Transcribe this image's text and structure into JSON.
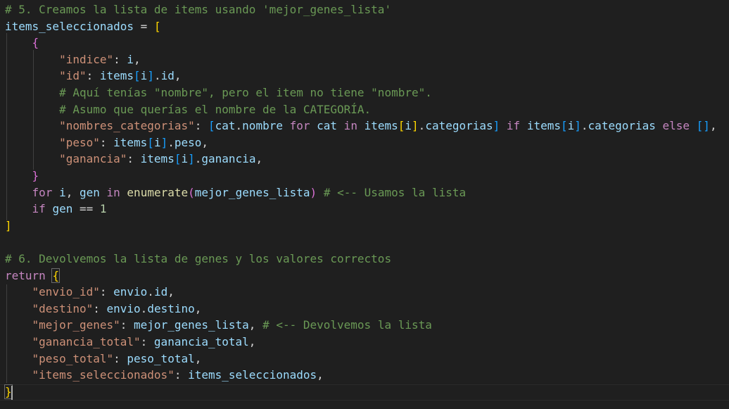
{
  "editor": {
    "language": "python",
    "theme": "dark",
    "lines": [
      [
        {
          "t": "# 5. Creamos la lista de items usando 'mejor_genes_lista'",
          "c": "comment"
        }
      ],
      [
        {
          "t": "items_seleccionados",
          "c": "var"
        },
        {
          "t": " = ",
          "c": "op"
        },
        {
          "t": "[",
          "c": "b1"
        }
      ],
      [
        {
          "t": "    ",
          "c": "plain"
        },
        {
          "t": "{",
          "c": "b2"
        }
      ],
      [
        {
          "t": "        ",
          "c": "plain"
        },
        {
          "t": "\"indice\"",
          "c": "str"
        },
        {
          "t": ": ",
          "c": "op"
        },
        {
          "t": "i",
          "c": "var"
        },
        {
          "t": ",",
          "c": "op"
        }
      ],
      [
        {
          "t": "        ",
          "c": "plain"
        },
        {
          "t": "\"id\"",
          "c": "str"
        },
        {
          "t": ": ",
          "c": "op"
        },
        {
          "t": "items",
          "c": "var"
        },
        {
          "t": "[",
          "c": "b3"
        },
        {
          "t": "i",
          "c": "var"
        },
        {
          "t": "]",
          "c": "b3"
        },
        {
          "t": ".",
          "c": "op"
        },
        {
          "t": "id",
          "c": "var"
        },
        {
          "t": ",",
          "c": "op"
        }
      ],
      [
        {
          "t": "        ",
          "c": "plain"
        },
        {
          "t": "# Aquí tenías \"nombre\", pero el item no tiene \"nombre\".",
          "c": "comment"
        }
      ],
      [
        {
          "t": "        ",
          "c": "plain"
        },
        {
          "t": "# Asumo que querías el nombre de la CATEGORÍA.",
          "c": "comment"
        }
      ],
      [
        {
          "t": "        ",
          "c": "plain"
        },
        {
          "t": "\"nombres_categorias\"",
          "c": "str"
        },
        {
          "t": ": ",
          "c": "op"
        },
        {
          "t": "[",
          "c": "b3"
        },
        {
          "t": "cat",
          "c": "var"
        },
        {
          "t": ".",
          "c": "op"
        },
        {
          "t": "nombre",
          "c": "var"
        },
        {
          "t": " for ",
          "c": "kw"
        },
        {
          "t": "cat",
          "c": "var"
        },
        {
          "t": " in ",
          "c": "kw"
        },
        {
          "t": "items",
          "c": "var"
        },
        {
          "t": "[",
          "c": "b1"
        },
        {
          "t": "i",
          "c": "var"
        },
        {
          "t": "]",
          "c": "b1"
        },
        {
          "t": ".",
          "c": "op"
        },
        {
          "t": "categorias",
          "c": "var"
        },
        {
          "t": "]",
          "c": "b3"
        },
        {
          "t": " if ",
          "c": "kw"
        },
        {
          "t": "items",
          "c": "var"
        },
        {
          "t": "[",
          "c": "b3"
        },
        {
          "t": "i",
          "c": "var"
        },
        {
          "t": "]",
          "c": "b3"
        },
        {
          "t": ".",
          "c": "op"
        },
        {
          "t": "categorias",
          "c": "var"
        },
        {
          "t": " else ",
          "c": "kw"
        },
        {
          "t": "[]",
          "c": "b3"
        },
        {
          "t": ",",
          "c": "op"
        }
      ],
      [
        {
          "t": "        ",
          "c": "plain"
        },
        {
          "t": "\"peso\"",
          "c": "str"
        },
        {
          "t": ": ",
          "c": "op"
        },
        {
          "t": "items",
          "c": "var"
        },
        {
          "t": "[",
          "c": "b3"
        },
        {
          "t": "i",
          "c": "var"
        },
        {
          "t": "]",
          "c": "b3"
        },
        {
          "t": ".",
          "c": "op"
        },
        {
          "t": "peso",
          "c": "var"
        },
        {
          "t": ",",
          "c": "op"
        }
      ],
      [
        {
          "t": "        ",
          "c": "plain"
        },
        {
          "t": "\"ganancia\"",
          "c": "str"
        },
        {
          "t": ": ",
          "c": "op"
        },
        {
          "t": "items",
          "c": "var"
        },
        {
          "t": "[",
          "c": "b3"
        },
        {
          "t": "i",
          "c": "var"
        },
        {
          "t": "]",
          "c": "b3"
        },
        {
          "t": ".",
          "c": "op"
        },
        {
          "t": "ganancia",
          "c": "var"
        },
        {
          "t": ",",
          "c": "op"
        }
      ],
      [
        {
          "t": "    ",
          "c": "plain"
        },
        {
          "t": "}",
          "c": "b2"
        }
      ],
      [
        {
          "t": "    ",
          "c": "plain"
        },
        {
          "t": "for",
          "c": "kw"
        },
        {
          "t": " ",
          "c": "plain"
        },
        {
          "t": "i",
          "c": "var"
        },
        {
          "t": ", ",
          "c": "op"
        },
        {
          "t": "gen",
          "c": "var"
        },
        {
          "t": " in ",
          "c": "kw"
        },
        {
          "t": "enumerate",
          "c": "fn"
        },
        {
          "t": "(",
          "c": "b2"
        },
        {
          "t": "mejor_genes_lista",
          "c": "var"
        },
        {
          "t": ")",
          "c": "b2"
        },
        {
          "t": " ",
          "c": "plain"
        },
        {
          "t": "# <-- Usamos la lista",
          "c": "comment"
        }
      ],
      [
        {
          "t": "    ",
          "c": "plain"
        },
        {
          "t": "if",
          "c": "kw"
        },
        {
          "t": " ",
          "c": "plain"
        },
        {
          "t": "gen",
          "c": "var"
        },
        {
          "t": " == ",
          "c": "op"
        },
        {
          "t": "1",
          "c": "num"
        }
      ],
      [
        {
          "t": "]",
          "c": "b1"
        }
      ],
      [],
      [
        {
          "t": "# 6. Devolvemos la lista de genes y los valores correctos",
          "c": "comment"
        }
      ],
      [
        {
          "t": "return",
          "c": "kw"
        },
        {
          "t": " ",
          "c": "plain"
        },
        {
          "t": "{",
          "c": "b1"
        }
      ],
      [
        {
          "t": "    ",
          "c": "plain"
        },
        {
          "t": "\"envio_id\"",
          "c": "str"
        },
        {
          "t": ": ",
          "c": "op"
        },
        {
          "t": "envio",
          "c": "var"
        },
        {
          "t": ".",
          "c": "op"
        },
        {
          "t": "id",
          "c": "var"
        },
        {
          "t": ",",
          "c": "op"
        }
      ],
      [
        {
          "t": "    ",
          "c": "plain"
        },
        {
          "t": "\"destino\"",
          "c": "str"
        },
        {
          "t": ": ",
          "c": "op"
        },
        {
          "t": "envio",
          "c": "var"
        },
        {
          "t": ".",
          "c": "op"
        },
        {
          "t": "destino",
          "c": "var"
        },
        {
          "t": ",",
          "c": "op"
        }
      ],
      [
        {
          "t": "    ",
          "c": "plain"
        },
        {
          "t": "\"mejor_genes\"",
          "c": "str"
        },
        {
          "t": ": ",
          "c": "op"
        },
        {
          "t": "mejor_genes_lista",
          "c": "var"
        },
        {
          "t": ", ",
          "c": "op"
        },
        {
          "t": "# <-- Devolvemos la lista",
          "c": "comment"
        }
      ],
      [
        {
          "t": "    ",
          "c": "plain"
        },
        {
          "t": "\"ganancia_total\"",
          "c": "str"
        },
        {
          "t": ": ",
          "c": "op"
        },
        {
          "t": "ganancia_total",
          "c": "var"
        },
        {
          "t": ",",
          "c": "op"
        }
      ],
      [
        {
          "t": "    ",
          "c": "plain"
        },
        {
          "t": "\"peso_total\"",
          "c": "str"
        },
        {
          "t": ": ",
          "c": "op"
        },
        {
          "t": "peso_total",
          "c": "var"
        },
        {
          "t": ",",
          "c": "op"
        }
      ],
      [
        {
          "t": "    ",
          "c": "plain"
        },
        {
          "t": "\"items_seleccionados\"",
          "c": "str"
        },
        {
          "t": ": ",
          "c": "op"
        },
        {
          "t": "items_seleccionados",
          "c": "var"
        },
        {
          "t": ",",
          "c": "op"
        }
      ],
      [
        {
          "t": "}",
          "c": "b1"
        }
      ]
    ]
  }
}
